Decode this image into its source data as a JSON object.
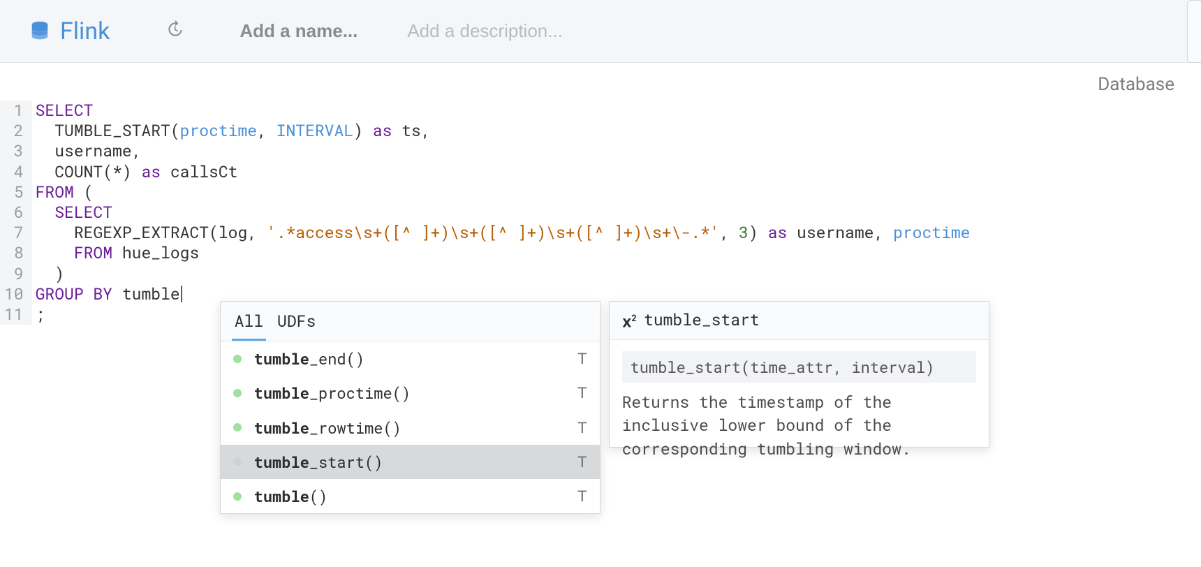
{
  "header": {
    "engine": "Flink",
    "name_placeholder": "Add a name...",
    "desc_placeholder": "Add a description...",
    "db_label": "Database"
  },
  "code_lines": [
    {
      "n": 1,
      "tokens": [
        {
          "t": "SELECT",
          "c": "kw"
        }
      ]
    },
    {
      "n": 2,
      "tokens": [
        {
          "t": "  TUMBLE_START(",
          "c": ""
        },
        {
          "t": "proctime",
          "c": "id"
        },
        {
          "t": ", ",
          "c": ""
        },
        {
          "t": "INTERVAL",
          "c": "id"
        },
        {
          "t": ") ",
          "c": ""
        },
        {
          "t": "as",
          "c": "kw"
        },
        {
          "t": " ts,",
          "c": ""
        }
      ]
    },
    {
      "n": 3,
      "tokens": [
        {
          "t": "  username,",
          "c": ""
        }
      ]
    },
    {
      "n": 4,
      "tokens": [
        {
          "t": "  COUNT(*) ",
          "c": ""
        },
        {
          "t": "as",
          "c": "kw"
        },
        {
          "t": " callsCt",
          "c": ""
        }
      ]
    },
    {
      "n": 5,
      "tokens": [
        {
          "t": "FROM",
          "c": "kw"
        },
        {
          "t": " (",
          "c": ""
        }
      ]
    },
    {
      "n": 6,
      "tokens": [
        {
          "t": "  ",
          "c": ""
        },
        {
          "t": "SELECT",
          "c": "kw"
        }
      ]
    },
    {
      "n": 7,
      "tokens": [
        {
          "t": "    REGEXP_EXTRACT(log, ",
          "c": ""
        },
        {
          "t": "'.*access\\s+([^ ]+)\\s+([^ ]+)\\s+([^ ]+)\\s+\\-.*'",
          "c": "str"
        },
        {
          "t": ", ",
          "c": ""
        },
        {
          "t": "3",
          "c": "num"
        },
        {
          "t": ") ",
          "c": ""
        },
        {
          "t": "as",
          "c": "kw"
        },
        {
          "t": " username, ",
          "c": ""
        },
        {
          "t": "proctime",
          "c": "id"
        }
      ]
    },
    {
      "n": 8,
      "tokens": [
        {
          "t": "    ",
          "c": ""
        },
        {
          "t": "FROM",
          "c": "kw"
        },
        {
          "t": " hue_logs",
          "c": ""
        }
      ]
    },
    {
      "n": 9,
      "tokens": [
        {
          "t": "  )",
          "c": ""
        }
      ]
    },
    {
      "n": 10,
      "tokens": [
        {
          "t": "GROUP BY",
          "c": "kw"
        },
        {
          "t": " tumble",
          "c": ""
        },
        {
          "t": "__CURSOR__",
          "c": "cursor"
        }
      ]
    },
    {
      "n": 11,
      "tokens": [
        {
          "t": ";",
          "c": ""
        }
      ]
    }
  ],
  "autocomplete": {
    "tabs": [
      {
        "label": "All",
        "active": true
      },
      {
        "label": "UDFs",
        "active": false
      }
    ],
    "items": [
      {
        "match": "tumble",
        "rest": "_end()",
        "type": "T",
        "selected": false
      },
      {
        "match": "tumble",
        "rest": "_proctime()",
        "type": "T",
        "selected": false
      },
      {
        "match": "tumble",
        "rest": "_rowtime()",
        "type": "T",
        "selected": false
      },
      {
        "match": "tumble",
        "rest": "_start()",
        "type": "T",
        "selected": true
      },
      {
        "match": "tumble",
        "rest": "()",
        "type": "T",
        "selected": false
      }
    ],
    "detail": {
      "name": "tumble_start",
      "signature": "tumble_start(time_attr, interval)",
      "description": "Returns the timestamp of the inclusive lower bound of the corresponding tumbling window."
    }
  }
}
